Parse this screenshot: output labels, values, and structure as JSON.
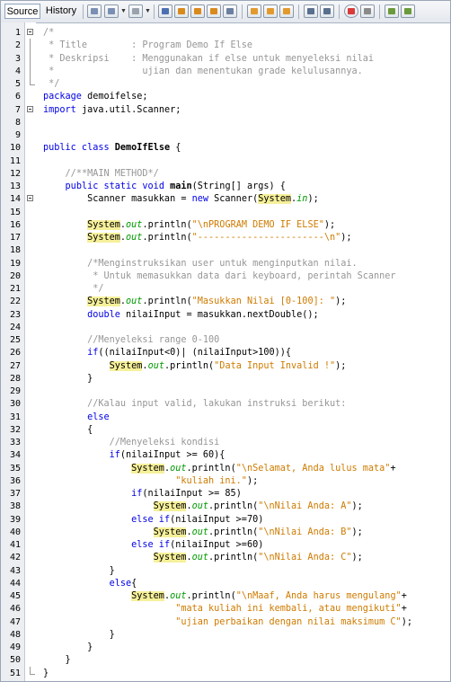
{
  "toolbar": {
    "tabs": [
      {
        "label": "Source",
        "active": true
      },
      {
        "label": "History",
        "active": false
      }
    ],
    "icons": [
      "last-edit-icon",
      "back-icon",
      "forward-icon",
      "find-icon",
      "find-previous-icon",
      "find-next-icon",
      "find-selection-icon",
      "toggle-highlight-icon",
      "toggle-rectangular-icon",
      "previous-bookmark-icon",
      "next-bookmark-icon",
      "toggle-bookmark-icon",
      "shift-left-icon",
      "shift-right-icon",
      "record-macro-icon",
      "stop-macro-icon",
      "comment-icon",
      "uncomment-icon"
    ]
  },
  "editor": {
    "lines": [
      {
        "n": "1",
        "html": "<span class='cm'>/*</span>"
      },
      {
        "n": "2",
        "html": "<span class='cm'> * Title        : Program Demo If Else</span>"
      },
      {
        "n": "3",
        "html": "<span class='cm'> * Deskripsi    : Menggunakan if else untuk menyeleksi nilai</span>"
      },
      {
        "n": "4",
        "html": "<span class='cm'> *                ujian dan menentukan grade kelulusannya.</span>"
      },
      {
        "n": "5",
        "html": "<span class='cm'> */</span>"
      },
      {
        "n": "6",
        "html": "<span class='kw'>package</span> demoifelse;"
      },
      {
        "n": "7",
        "html": "<span class='kw'>import</span> java.util.Scanner;"
      },
      {
        "n": "8",
        "html": ""
      },
      {
        "n": "9",
        "html": ""
      },
      {
        "n": "10",
        "html": "<span class='kw'>public class</span> <span class='fn'>DemoIfElse</span> {"
      },
      {
        "n": "11",
        "html": ""
      },
      {
        "n": "12",
        "html": "    <span class='cm'>//**MAIN METHOD*/</span>"
      },
      {
        "n": "13",
        "html": "    <span class='kw'>public static void</span> <span class='fn'>main</span>(String[] args) {"
      },
      {
        "n": "14",
        "html": "        Scanner masukkan = <span class='kw'>new</span> Scanner(<span class='sys'>System</span>.<span class='out'>in</span>);"
      },
      {
        "n": "15",
        "html": ""
      },
      {
        "n": "16",
        "html": "        <span class='sys'>System</span>.<span class='out'>out</span>.println(<span class='st'>\"\\nPROGRAM DEMO IF ELSE\"</span>);"
      },
      {
        "n": "17",
        "html": "        <span class='sys'>System</span>.<span class='out'>out</span>.println(<span class='st'>\"-----------------------\\n\"</span>);"
      },
      {
        "n": "18",
        "html": ""
      },
      {
        "n": "19",
        "html": "        <span class='cm'>/*Menginstruksikan user untuk menginputkan nilai.</span>"
      },
      {
        "n": "20",
        "html": "<span class='cm'>         * Untuk memasukkan data dari keyboard, perintah Scanner</span>"
      },
      {
        "n": "21",
        "html": "<span class='cm'>         */</span>"
      },
      {
        "n": "22",
        "html": "        <span class='sys'>System</span>.<span class='out'>out</span>.println(<span class='st'>\"Masukkan Nilai [0-100]: \"</span>);"
      },
      {
        "n": "23",
        "html": "        <span class='kw'>double</span> nilaiInput = masukkan.nextDouble();"
      },
      {
        "n": "24",
        "html": ""
      },
      {
        "n": "25",
        "html": "        <span class='cm'>//Menyeleksi range 0-100</span>"
      },
      {
        "n": "26",
        "html": "        <span class='kw'>if</span>((nilaiInput&lt;0)| (nilaiInput&gt;100)){"
      },
      {
        "n": "27",
        "html": "            <span class='sys'>System</span>.<span class='out'>out</span>.println(<span class='st'>\"Data Input Invalid !\"</span>);"
      },
      {
        "n": "28",
        "html": "        }"
      },
      {
        "n": "29",
        "html": ""
      },
      {
        "n": "30",
        "html": "        <span class='cm'>//Kalau input valid, lakukan instruksi berikut:</span>"
      },
      {
        "n": "31",
        "html": "        <span class='kw'>else</span>"
      },
      {
        "n": "32",
        "html": "        {"
      },
      {
        "n": "33",
        "html": "            <span class='cm'>//Menyeleksi kondisi</span>"
      },
      {
        "n": "34",
        "html": "            <span class='kw'>if</span>(nilaiInput &gt;= 60){"
      },
      {
        "n": "35",
        "html": "                <span class='sys'>System</span>.<span class='out'>out</span>.println(<span class='st'>\"\\nSelamat, Anda lulus mata\"</span>+"
      },
      {
        "n": "36",
        "html": "                        <span class='st'>\"kuliah ini.\"</span>);"
      },
      {
        "n": "37",
        "html": "                <span class='kw'>if</span>(nilaiInput &gt;= 85)"
      },
      {
        "n": "38",
        "html": "                    <span class='sys'>System</span>.<span class='out'>out</span>.println(<span class='st'>\"\\nNilai Anda: A\"</span>);"
      },
      {
        "n": "39",
        "html": "                <span class='kw'>else if</span>(nilaiInput &gt;=70)"
      },
      {
        "n": "40",
        "html": "                    <span class='sys'>System</span>.<span class='out'>out</span>.println(<span class='st'>\"\\nNilai Anda: B\"</span>);"
      },
      {
        "n": "41",
        "html": "                <span class='kw'>else if</span>(nilaiInput &gt;=60)"
      },
      {
        "n": "42",
        "html": "                    <span class='sys'>System</span>.<span class='out'>out</span>.println(<span class='st'>\"\\nNilai Anda: C\"</span>);"
      },
      {
        "n": "43",
        "html": "            }"
      },
      {
        "n": "44",
        "html": "            <span class='kw'>else</span>{"
      },
      {
        "n": "45",
        "html": "                <span class='sys'>System</span>.<span class='out'>out</span>.println(<span class='st'>\"\\nMaaf, Anda harus mengulang\"</span>+"
      },
      {
        "n": "46",
        "html": "                        <span class='st'>\"mata kuliah ini kembali, atau mengikuti\"</span>+"
      },
      {
        "n": "47",
        "html": "                        <span class='st'>\"ujian perbaikan dengan nilai maksimum C\"</span>);"
      },
      {
        "n": "48",
        "html": "            }"
      },
      {
        "n": "49",
        "html": "        }"
      },
      {
        "n": "50",
        "html": "    }"
      },
      {
        "n": "51",
        "html": "}"
      }
    ],
    "fold_open": [
      "1",
      "7",
      "14",
      "52"
    ],
    "fold_end": [
      "5",
      "51"
    ]
  }
}
